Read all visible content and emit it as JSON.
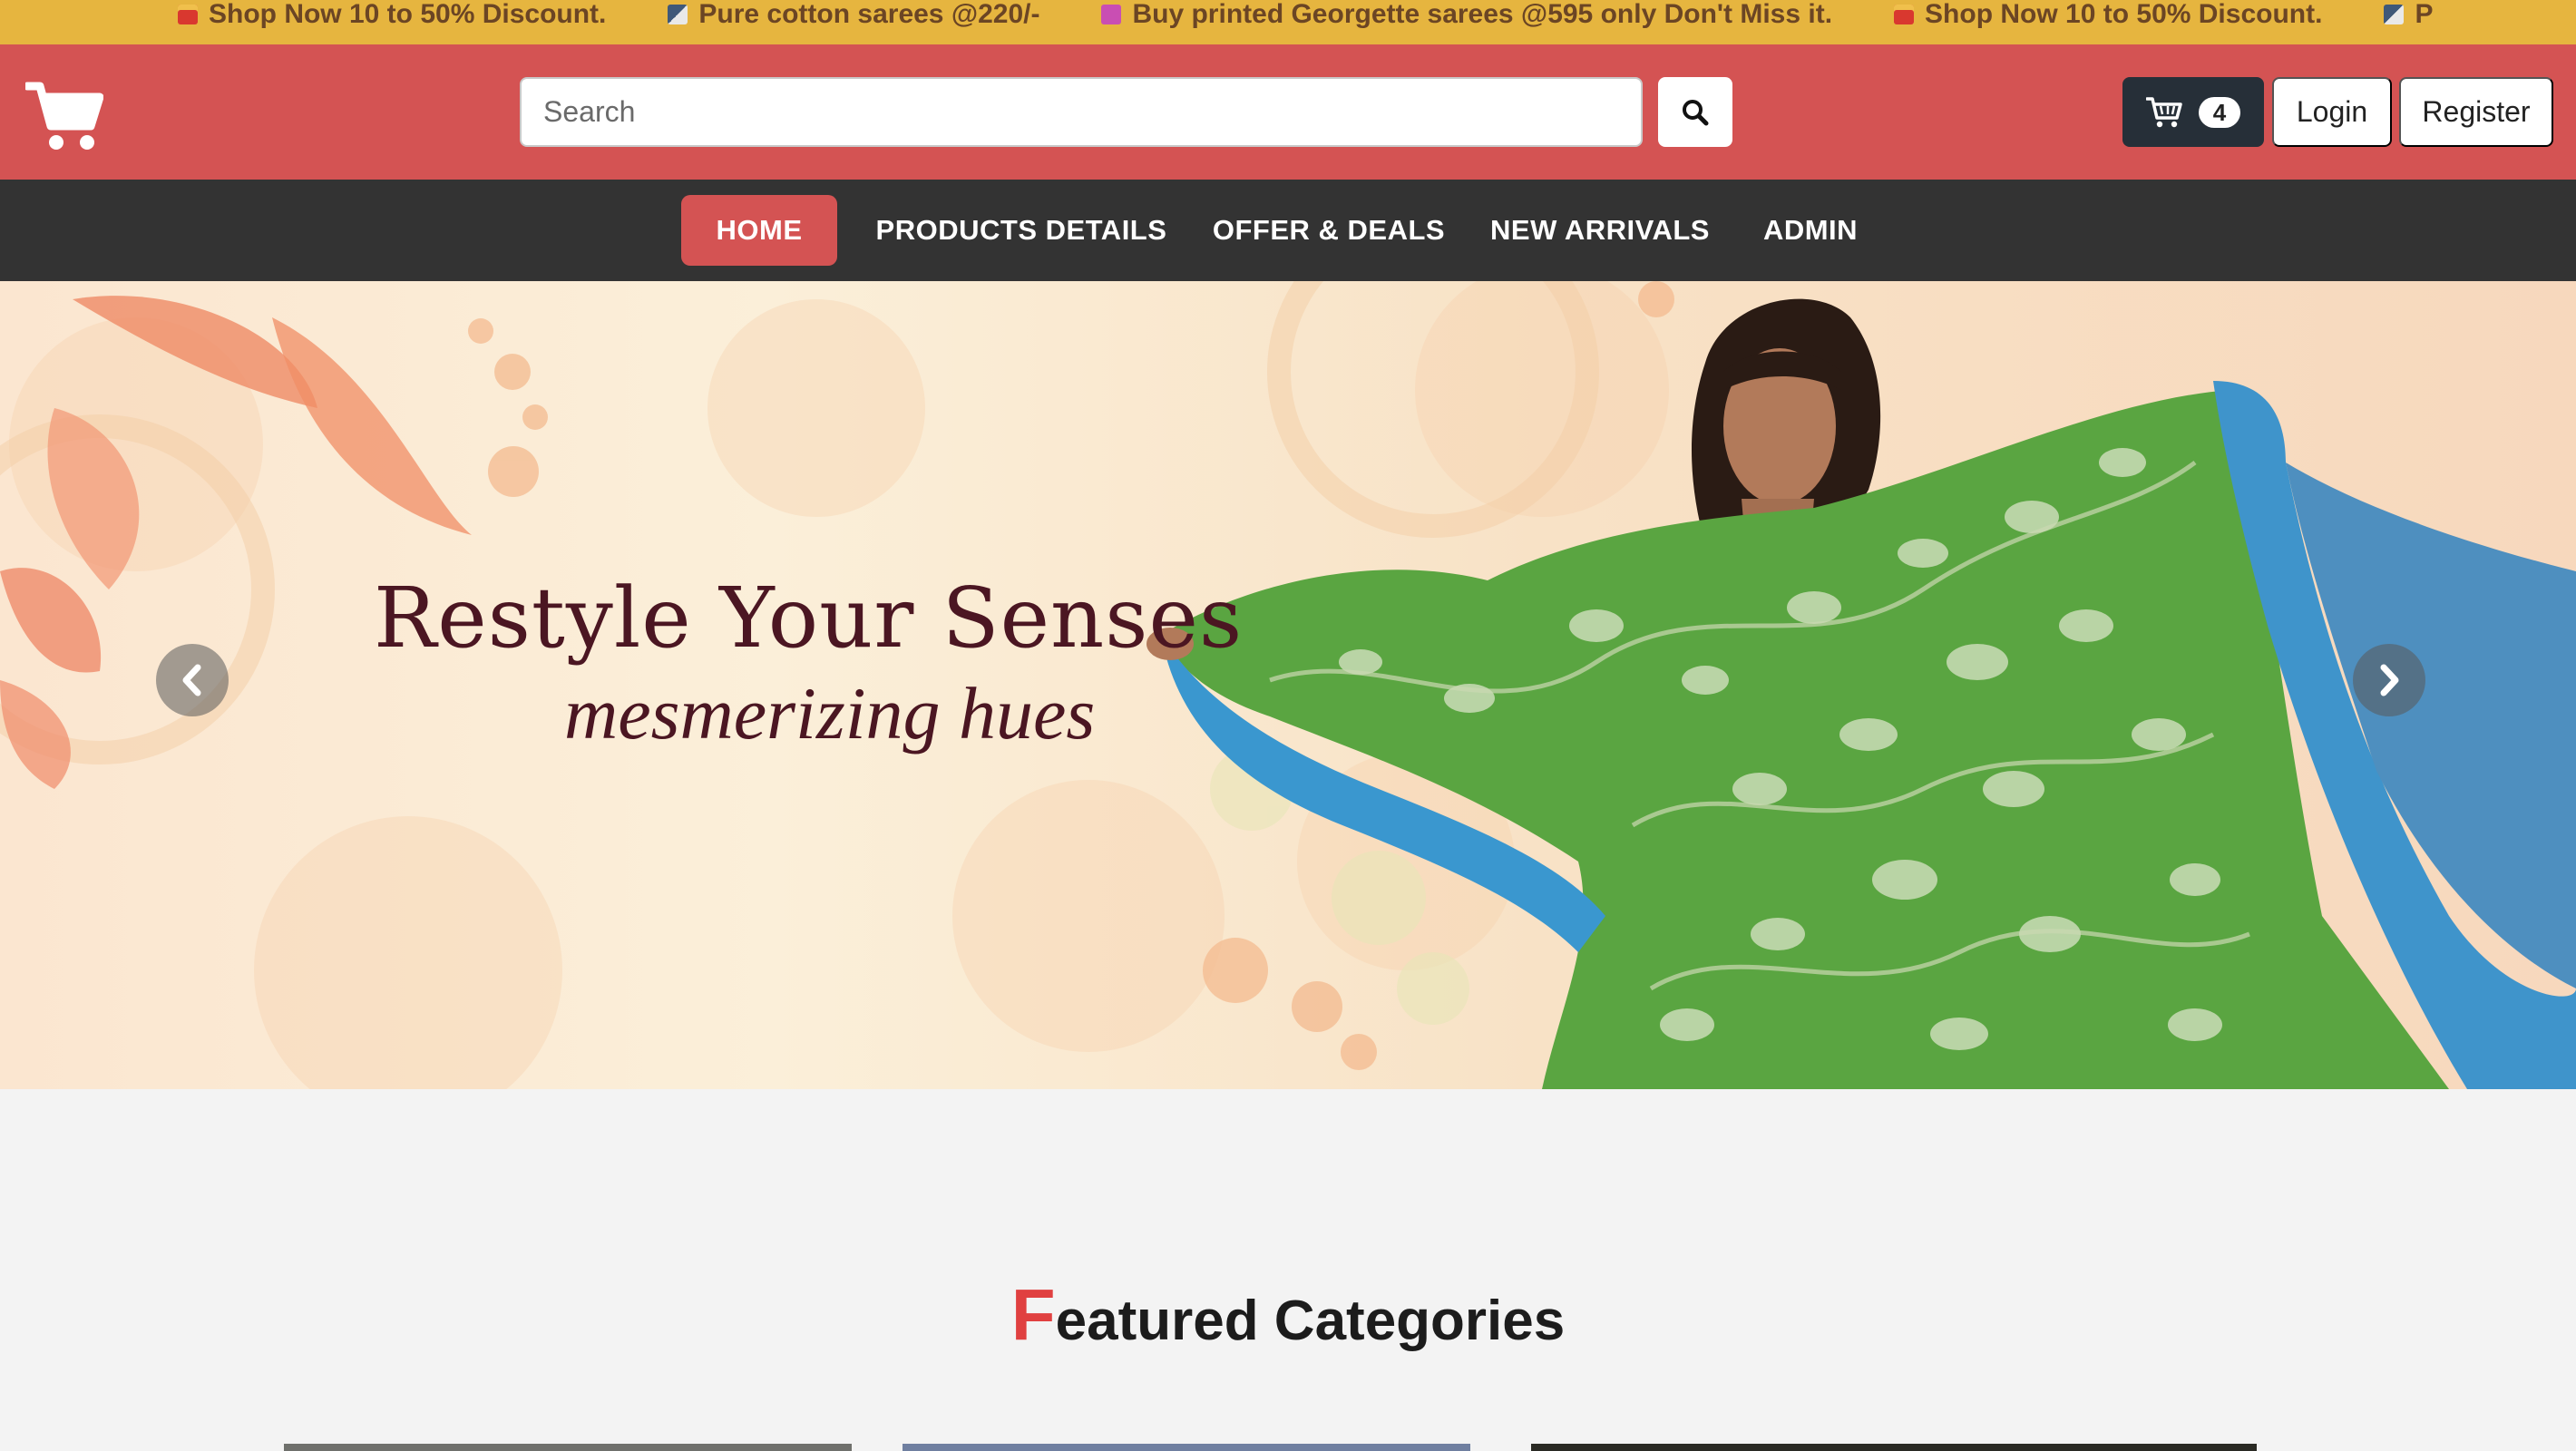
{
  "marquee": {
    "items": [
      {
        "icon": "gift-icon",
        "text": "Shop Now 10 to 50% Discount."
      },
      {
        "icon": "flag-icon",
        "text": "Pure cotton sarees @220/-"
      },
      {
        "icon": "shopping-bags-icon",
        "text": "Buy printed Georgette sarees @595 only Don't Miss it."
      },
      {
        "icon": "gift-icon",
        "text": "Shop Now 10 to 50% Discount."
      },
      {
        "icon": "flag-icon",
        "text": "P"
      }
    ]
  },
  "header": {
    "logo_icon": "shopping-cart-icon",
    "search": {
      "placeholder": "Search",
      "value": ""
    },
    "search_button_icon": "search-icon",
    "cart": {
      "icon": "cart-icon",
      "count": "4"
    },
    "login_label": "Login",
    "register_label": "Register"
  },
  "nav": {
    "items": [
      {
        "label": "HOME",
        "active": true
      },
      {
        "label": "PRODUCTS DETAILS"
      },
      {
        "label": "OFFER & DEALS"
      },
      {
        "label": "NEW ARRIVALS"
      },
      {
        "label": "ADMIN"
      }
    ]
  },
  "hero": {
    "title": "Restyle Your Senses",
    "subtitle": "mesmerizing hues",
    "prev_icon": "chevron-left-icon",
    "next_icon": "chevron-right-icon"
  },
  "featured": {
    "first_letter": "F",
    "rest": "eatured Categories"
  },
  "colors": {
    "marquee_bg": "#e6b53f",
    "header_bg": "#d45353",
    "nav_bg": "#333333",
    "accent": "#d45353",
    "cart_bg": "#262f38"
  }
}
